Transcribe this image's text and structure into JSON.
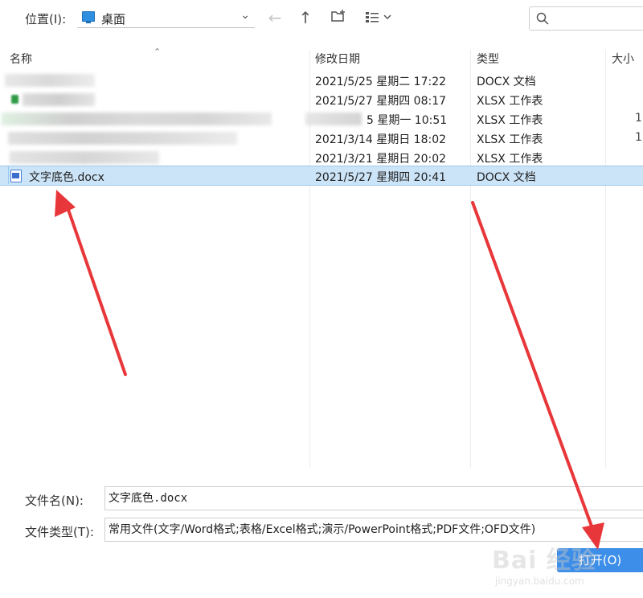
{
  "toolbar": {
    "location_label": "位置(I):",
    "location_value": "桌面",
    "back_icon": "arrow-left-icon",
    "up_icon": "arrow-up-icon",
    "new_folder_icon": "new-folder-icon",
    "view_icon": "view-list-icon",
    "search_icon": "search-icon"
  },
  "columns": {
    "name": "名称",
    "modified": "修改日期",
    "type": "类型",
    "size": "大小"
  },
  "files": [
    {
      "name": "",
      "modified": "2021/5/25 星期二 17:22",
      "type": "DOCX 文档",
      "size": ""
    },
    {
      "name": "",
      "modified": "2021/5/27 星期四 08:17",
      "type": "XLSX 工作表",
      "size": ""
    },
    {
      "name": "",
      "modified": "5 星期一 10:51",
      "type": "XLSX 工作表",
      "size": "1"
    },
    {
      "name": "",
      "modified": "2021/3/14 星期日 18:02",
      "type": "XLSX 工作表",
      "size": "1"
    },
    {
      "name": "",
      "modified": "2021/3/21 星期日 20:02",
      "type": "XLSX 工作表",
      "size": ""
    },
    {
      "name": "文字底色.docx",
      "modified": "2021/5/27 星期四 20:41",
      "type": "DOCX 文档",
      "size": ""
    }
  ],
  "footer": {
    "filename_label": "文件名(N):",
    "filename_value": "文字底色.docx",
    "filetype_label": "文件类型(T):",
    "filetype_value": "常用文件(文字/Word格式;表格/Excel格式;演示/PowerPoint格式;PDF文件;OFD文件)",
    "open_button": "打开(O)"
  },
  "watermark": {
    "brand": "Bai 经验",
    "url": "jingyan.baidu.com"
  },
  "colors": {
    "selection": "#cce4f7",
    "accent": "#3d8ee8",
    "annotation_arrow": "#e8373a"
  }
}
